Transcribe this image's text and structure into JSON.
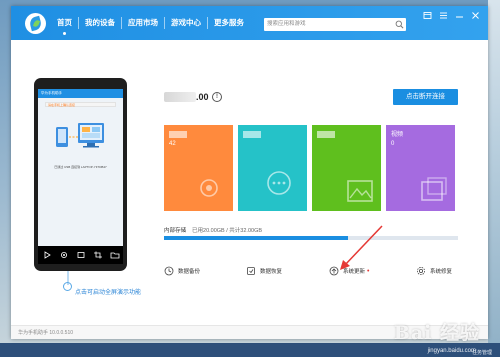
{
  "window": {
    "nav": [
      {
        "label": "首页",
        "active": true
      },
      {
        "label": "我的设备",
        "active": false
      },
      {
        "label": "应用市场",
        "active": false
      },
      {
        "label": "游戏中心",
        "active": false
      },
      {
        "label": "更多服务",
        "active": false
      }
    ],
    "search_placeholder": "搜索应用和游戏"
  },
  "phone": {
    "screen_title": "华为手机助手",
    "screen_tip": "请在手机上确认连接",
    "screen_text": "已通过 USB 连接到 LAPTOP-YF7DB47",
    "hint": "点击可启动全屏演示功能"
  },
  "device": {
    "model_suffix": ".00",
    "disconnect_label": "点击断开连接"
  },
  "categories": [
    {
      "label": "",
      "count": "42",
      "color": "#ff8a3d"
    },
    {
      "label": "",
      "count": "",
      "color": "#25c2c8"
    },
    {
      "label": "",
      "count": "",
      "color": "#5fbf1e"
    },
    {
      "label": "视频",
      "count": "0",
      "color": "#a56be0"
    }
  ],
  "storage": {
    "label": "内部存储",
    "usage": "已用20.00GB / 共计32.00GB",
    "used_fraction": 0.625
  },
  "actions": [
    {
      "label": "数据备份"
    },
    {
      "label": "数据恢复"
    },
    {
      "label": "系统更新",
      "badge": "•"
    },
    {
      "label": "系统修复"
    }
  ],
  "status": {
    "version": "华为手机助手 10.0.0.510"
  },
  "watermark": {
    "main": "Bai 经验",
    "sub": "jingyan.baidu.com"
  },
  "taskbar": {
    "tray_text": "任务管理"
  },
  "colors": {
    "titlebar": "#2398e6",
    "accent": "#1a8ee1",
    "annotation": "#2a84d6",
    "red_arrow": "#e53935"
  }
}
